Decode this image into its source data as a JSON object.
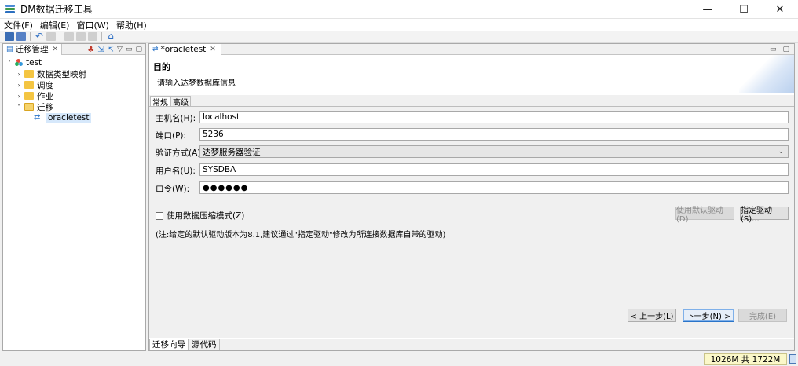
{
  "window": {
    "title": "DM数据迁移工具",
    "minimize": "—",
    "maximize": "☐",
    "close": "✕"
  },
  "menu": [
    "文件(F)",
    "编辑(E)",
    "窗口(W)",
    "帮助(H)"
  ],
  "left_view": {
    "tab_label": "迁移管理",
    "close": "✕",
    "tree": {
      "root": "test",
      "items": [
        {
          "label": "数据类型映射",
          "icon": "folder-icon",
          "expanded": false
        },
        {
          "label": "调度",
          "icon": "folder-icon",
          "expanded": false
        },
        {
          "label": "作业",
          "icon": "folder-icon",
          "expanded": false
        },
        {
          "label": "迁移",
          "icon": "folder-open-icon",
          "expanded": true
        }
      ],
      "child": "oracletest"
    }
  },
  "editor": {
    "tab_label": "*oracletest",
    "close": "✕",
    "header": {
      "title": "目的",
      "description": "请输入达梦数据库信息"
    },
    "sub_tabs": [
      "常规",
      "高级"
    ],
    "form": {
      "host_label": "主机名(H):",
      "host_value": "localhost",
      "port_label": "端口(P):",
      "port_value": "5236",
      "auth_label": "验证方式(A):",
      "auth_value": "达梦服务器验证",
      "user_label": "用户名(U):",
      "user_value": "SYSDBA",
      "pwd_label": "口令(W):",
      "pwd_value": "●●●●●●",
      "compress_label": "使用数据压缩模式(Z)",
      "default_driver_btn": "使用默认驱动(D)",
      "specify_driver_btn": "指定驱动(S)...",
      "note": "(注:给定的默认驱动版本为8.1,建议通过\"指定驱动\"修改为所连接数据库自带的驱动)"
    },
    "nav": {
      "back": "< 上一步(L)",
      "next": "下一步(N) >",
      "finish": "完成(E)"
    },
    "bottom_tabs": [
      "迁移向导",
      "源代码"
    ]
  },
  "status": {
    "heap": "1026M 共 1722M"
  }
}
